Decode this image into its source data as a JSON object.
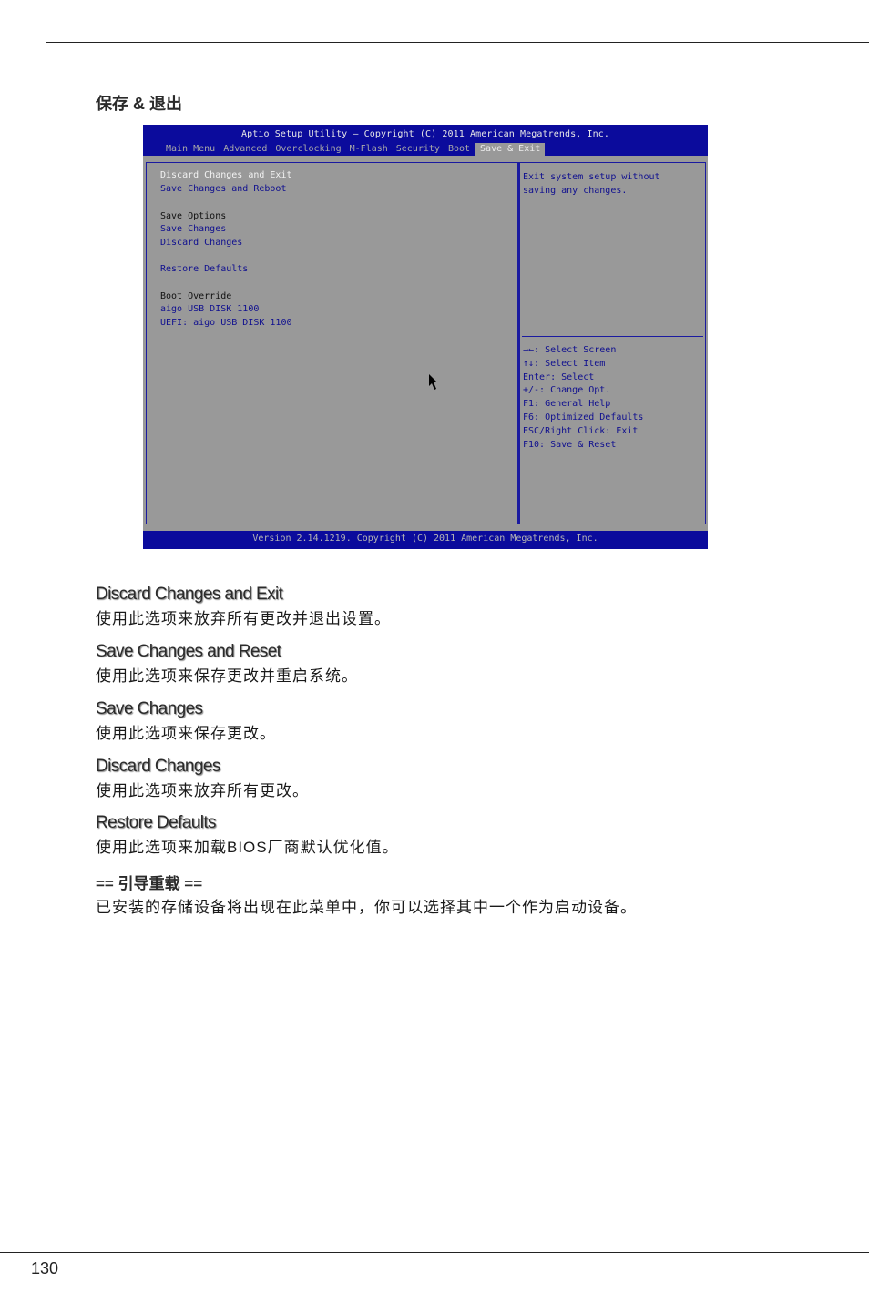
{
  "page": {
    "section_title": "保存 & 退出",
    "page_number": "130"
  },
  "bios": {
    "title": "Aptio Setup Utility – Copyright (C) 2011 American Megatrends, Inc.",
    "tabs": [
      {
        "label": "Main Menu",
        "active": false
      },
      {
        "label": "Advanced",
        "active": false
      },
      {
        "label": "Overclocking",
        "active": false
      },
      {
        "label": "M-Flash",
        "active": false
      },
      {
        "label": "Security",
        "active": false
      },
      {
        "label": "Boot",
        "active": false
      },
      {
        "label": "Save & Exit",
        "active": true
      }
    ],
    "menu_items": [
      {
        "label": "Discard Changes and Exit",
        "style": "selected"
      },
      {
        "label": "Save Changes and Reboot",
        "style": "link"
      },
      {
        "label": "Save Options",
        "style": "label"
      },
      {
        "label": "Save Changes",
        "style": "link"
      },
      {
        "label": "Discard Changes",
        "style": "link"
      },
      {
        "label": "Restore Defaults",
        "style": "link"
      },
      {
        "label": "Boot Override",
        "style": "label"
      },
      {
        "label": "aigo USB DISK 1100",
        "style": "link"
      },
      {
        "label": "UEFI: aigo USB DISK 1100",
        "style": "link"
      }
    ],
    "help_text": "Exit system setup without\nsaving any changes.",
    "key_help": [
      "→←: Select Screen",
      "↑↓: Select Item",
      "Enter: Select",
      "+/-: Change Opt.",
      "F1: General Help",
      "F6: Optimized Defaults",
      "ESC/Right Click: Exit",
      "F10: Save & Reset"
    ],
    "footer": "Version 2.14.1219. Copyright (C) 2011 American Megatrends, Inc.",
    "colors": {
      "header_blue": "#0b0b9c",
      "panel_gray": "#999999",
      "link_blue": "#10108f"
    }
  },
  "descriptions": [
    {
      "title": "Discard Changes and Exit",
      "body": "使用此选项来放弃所有更改并退出设置。"
    },
    {
      "title": "Save Changes and Reset",
      "body": "使用此选项来保存更改并重启系统。"
    },
    {
      "title": "Save Changes",
      "body": "使用此选项来保存更改。"
    },
    {
      "title": "Discard Changes",
      "body": "使用此选项来放弃所有更改。"
    },
    {
      "title": "Restore Defaults",
      "body": "使用此选项来加载BIOS厂商默认优化值。"
    },
    {
      "title": "== 引导重载 ==",
      "body": "已安装的存储设备将出现在此菜单中，你可以选择其中一个作为启动设备。"
    }
  ]
}
